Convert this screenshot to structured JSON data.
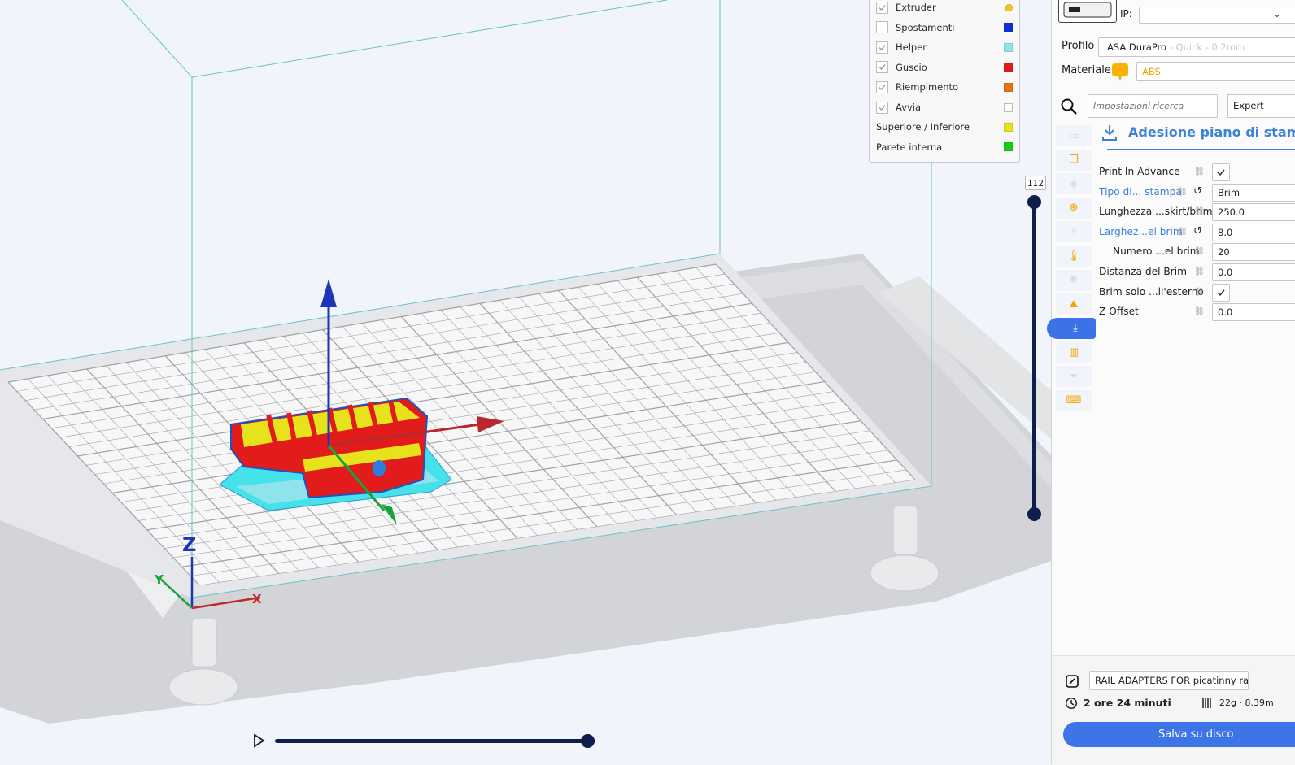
{
  "legend": {
    "items": [
      {
        "label": "Extruder",
        "checkbox": true,
        "checked": true,
        "color": "#f5c518",
        "swatch_shape": "drop"
      },
      {
        "label": "Spostamenti",
        "checkbox": true,
        "checked": false,
        "color": "#1030d8"
      },
      {
        "label": "Helper",
        "checkbox": true,
        "checked": true,
        "color": "#8fe3ea"
      },
      {
        "label": "Guscio",
        "checkbox": true,
        "checked": true,
        "color": "#e21b1b"
      },
      {
        "label": "Riempimento",
        "checkbox": true,
        "checked": true,
        "color": "#e07612"
      },
      {
        "label": "Avvia",
        "checkbox": true,
        "checked": true,
        "color": "#ffffff"
      },
      {
        "label": "Superiore / Inferiore",
        "checkbox": false,
        "color": "#e6e21b"
      },
      {
        "label": "Parete interna",
        "checkbox": false,
        "color": "#19cc19"
      }
    ]
  },
  "layer_slider": {
    "value": "112"
  },
  "axis_labels": {
    "z": "Z",
    "x": "X",
    "y": "Y"
  },
  "panel": {
    "ip_label": "IP:",
    "ip_value": "",
    "profile_label": "Profilo",
    "profile_name": "ASA DuraPro",
    "profile_quality": " - Quick - 0.2mm",
    "material_label": "Materiale",
    "material_value": "ABS",
    "material_color": "#f5b400",
    "search_placeholder": "Impostazioni ricerca",
    "mode_value": "Expert",
    "section_title": "Adesione piano di stampa",
    "settings": [
      {
        "label": "Print In Advance",
        "type": "check",
        "value": "",
        "blue": false,
        "indent": false,
        "reset": false
      },
      {
        "label": "Tipo di... stampa",
        "type": "text",
        "value": "Brim",
        "blue": true,
        "indent": false,
        "reset": true
      },
      {
        "label": "Lunghezza ...skirt/brim",
        "type": "text",
        "value": "250.0",
        "blue": false,
        "indent": false,
        "reset": false
      },
      {
        "label": "Larghez...el brim",
        "type": "text",
        "value": "8.0",
        "blue": true,
        "indent": false,
        "reset": true
      },
      {
        "label": "Numero ...el brim",
        "type": "text",
        "value": "20",
        "blue": false,
        "indent": true,
        "reset": false
      },
      {
        "label": "Distanza del Brim",
        "type": "text",
        "value": "0.0",
        "blue": false,
        "indent": false,
        "reset": false
      },
      {
        "label": "Brim solo ...ll'esterno",
        "type": "check",
        "value": "",
        "blue": false,
        "indent": false,
        "reset": false
      },
      {
        "label": "Z Offset",
        "type": "text",
        "value": "0.0",
        "blue": false,
        "indent": false,
        "reset": false
      }
    ],
    "sidebar_icons": [
      "monitor-icon",
      "copy-icon",
      "layers-icon",
      "plus-circle-icon",
      "power-icon",
      "thermometer-icon",
      "fan-icon",
      "support-icon",
      "download-icon",
      "bars-icon",
      "funnel-icon",
      "keyboard-icon"
    ],
    "active_icon_index": 8,
    "job_name": "RAIL ADAPTERS FOR picatinny rail",
    "print_time": "2 ore 24 minuti",
    "material_usage": "22g · 8.39m",
    "save_button": "Salva su disco"
  }
}
